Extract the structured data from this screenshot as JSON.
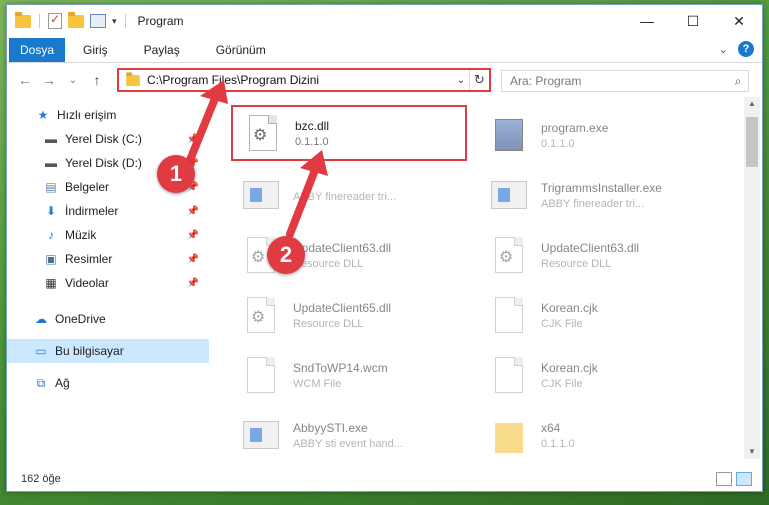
{
  "window": {
    "title": "Program"
  },
  "window_buttons": {
    "minimize": "—",
    "maximize": "☐",
    "close": "✕"
  },
  "ribbon": {
    "file": "Dosya",
    "tabs": [
      "Giriş",
      "Paylaş",
      "Görünüm"
    ],
    "help": "?"
  },
  "nav": {
    "back": "←",
    "forward": "→",
    "recent": "⌄",
    "up": "↑",
    "address": "C:\\Program Files\\Program Dizini",
    "search_placeholder": "Ara: Program"
  },
  "sidebar": {
    "items": [
      {
        "label": "Hızlı erişim",
        "icon": "star-icon"
      },
      {
        "label": "Yerel Disk (C:)",
        "icon": "drive-icon",
        "pinned": true
      },
      {
        "label": "Yerel Disk (D:)",
        "icon": "drive-icon",
        "pinned": true
      },
      {
        "label": "Belgeler",
        "icon": "documents-icon",
        "pinned": true
      },
      {
        "label": "İndirmeler",
        "icon": "downloads-icon",
        "pinned": true
      },
      {
        "label": "Müzik",
        "icon": "music-icon",
        "pinned": true
      },
      {
        "label": "Resimler",
        "icon": "pictures-icon",
        "pinned": true
      },
      {
        "label": "Videolar",
        "icon": "videos-icon",
        "pinned": true
      },
      {
        "label": "OneDrive",
        "icon": "cloud-icon"
      },
      {
        "label": "Bu bilgisayar",
        "icon": "computer-icon",
        "selected": true
      },
      {
        "label": "Ağ",
        "icon": "network-icon"
      }
    ]
  },
  "files": [
    {
      "name": "bzc.dll",
      "sub": "0.1.1.0",
      "kind": "dll",
      "highlight": true
    },
    {
      "name": "program.exe",
      "sub": "0.1.1.0",
      "kind": "program"
    },
    {
      "name": "",
      "sub": "ABBY finereader tri...",
      "kind": "exe"
    },
    {
      "name": "TrigrammsInstaller.exe",
      "sub": "ABBY finereader tri...",
      "kind": "exe"
    },
    {
      "name": "UpdateClient63.dll",
      "sub": "Resource DLL",
      "kind": "dll"
    },
    {
      "name": "UpdateClient63.dll",
      "sub": "Resource DLL",
      "kind": "dll"
    },
    {
      "name": "UpdateClient65.dll",
      "sub": "Resource DLL",
      "kind": "dll"
    },
    {
      "name": "Korean.cjk",
      "sub": "CJK File",
      "kind": "doc"
    },
    {
      "name": "SndToWP14.wcm",
      "sub": "WCM File",
      "kind": "doc"
    },
    {
      "name": "Korean.cjk",
      "sub": "CJK File",
      "kind": "doc"
    },
    {
      "name": "AbbyySTI.exe",
      "sub": "ABBY sti event hand...",
      "kind": "exe"
    },
    {
      "name": "x64",
      "sub": "0.1.1.0",
      "kind": "folder"
    }
  ],
  "status": {
    "count": "162 öğe"
  },
  "annotations": {
    "badge1": "1",
    "badge2": "2"
  },
  "colors": {
    "accent": "#1979ca",
    "highlight": "#e03a42",
    "selected": "#cce8ff"
  }
}
